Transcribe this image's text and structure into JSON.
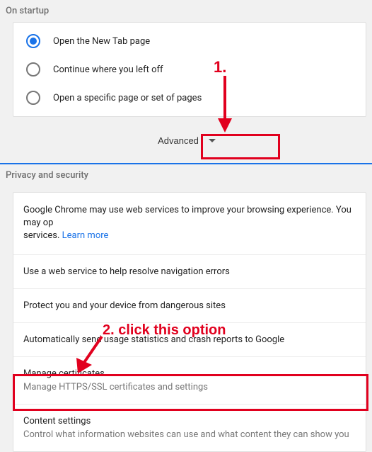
{
  "startup": {
    "header": "On startup",
    "options": {
      "newtab": "Open the New Tab page",
      "continue": "Continue where you left off",
      "specific": "Open a specific page or set of pages"
    }
  },
  "advanced": {
    "label": "Advanced"
  },
  "privacy": {
    "header": "Privacy and security",
    "intro_prefix": "Google Chrome may use web services to improve your browsing experience. You may op",
    "intro_suffix": "services. ",
    "learn_more": "Learn more",
    "rows": {
      "nav_errors": "Use a web service to help resolve navigation errors",
      "protect": "Protect you and your device from dangerous sites",
      "usage_stats": "Automatically send usage statistics and crash reports to Google",
      "certs_title": "Manage certificates",
      "certs_sub": "Manage HTTPS/SSL certificates and settings",
      "content_title": "Content settings",
      "content_sub": "Control what information websites can use and what content they can show you"
    }
  },
  "annotations": {
    "step1": "1.",
    "step2": "2. click this option"
  }
}
